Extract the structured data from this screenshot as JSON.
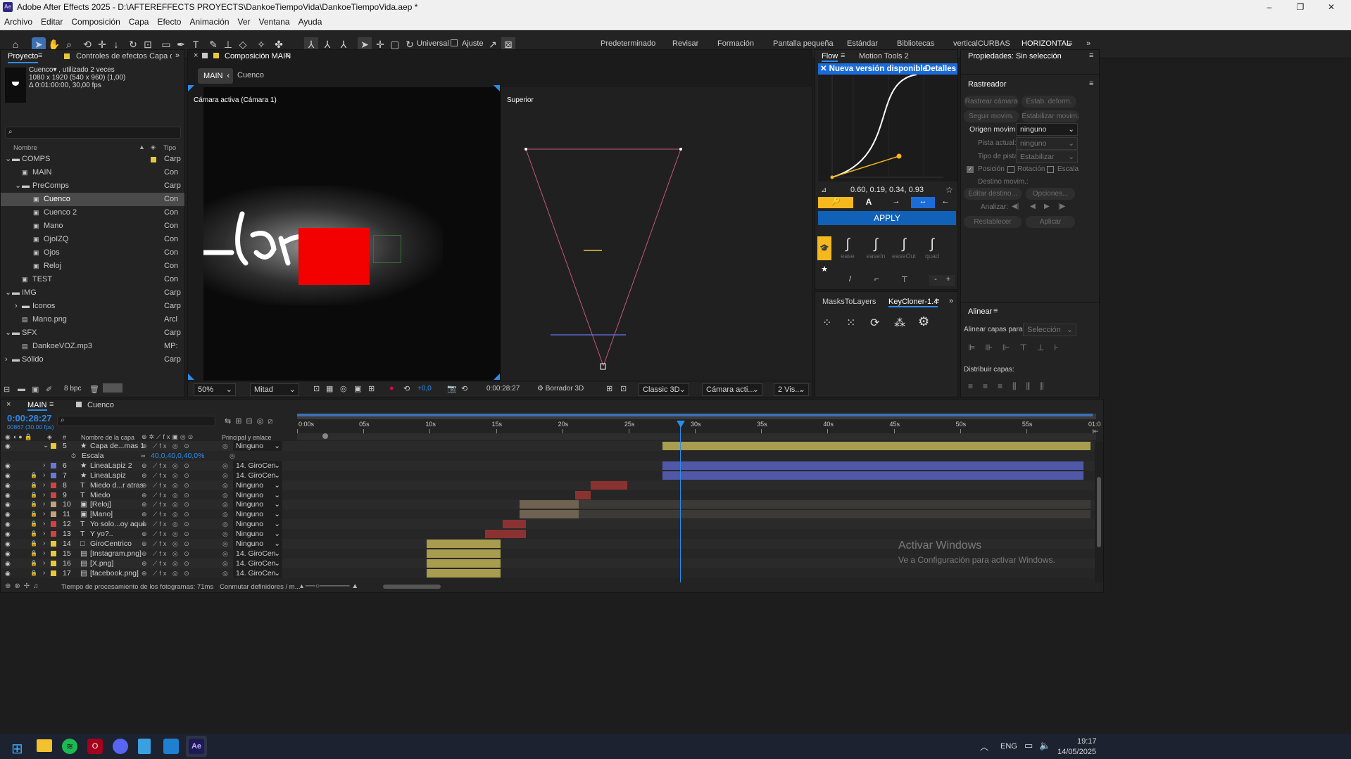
{
  "window": {
    "title": "Adobe After Effects 2025 - D:\\AFTEREFFECTS PROYECTS\\DankoeTiempoVida\\DankoeTiempoVida.aep *",
    "app_icon": "Ae"
  },
  "menu": [
    "Archivo",
    "Editar",
    "Composición",
    "Capa",
    "Efecto",
    "Animación",
    "Ver",
    "Ventana",
    "Ayuda"
  ],
  "toolbar": {
    "universal": "Universal",
    "ajuste": "Ajuste",
    "workspaces": [
      "Predeterminado",
      "Revisar",
      "Formación",
      "Pantalla pequeña",
      "Estándar",
      "Bibliotecas",
      "verticalCURBAS",
      "HORIZONTAL"
    ]
  },
  "project": {
    "tab": "Proyecto",
    "tab2": "Controles de efectos Capa de form",
    "info_name": "Cuenco▾ , utilizado 2 veces",
    "info_dims": "1080 x 1920  (540 x 960) (1,00)",
    "info_dur": "Δ 0:01:00:00, 30,00 fps",
    "col_name": "Nombre",
    "col_type": "Tipo",
    "bpc": "8 bpc",
    "items": [
      {
        "name": "COMPS",
        "type": "Carp"
      },
      {
        "name": "MAIN",
        "type": "Con"
      },
      {
        "name": "PreComps",
        "type": "Carp"
      },
      {
        "name": "Cuenco",
        "type": "Con"
      },
      {
        "name": "Cuenco 2",
        "type": "Con"
      },
      {
        "name": "Mano",
        "type": "Con"
      },
      {
        "name": "OjoIZQ",
        "type": "Con"
      },
      {
        "name": "Ojos",
        "type": "Con"
      },
      {
        "name": "Reloj",
        "type": "Con"
      },
      {
        "name": "TEST",
        "type": "Con"
      },
      {
        "name": "IMG",
        "type": "Carp"
      },
      {
        "name": "Iconos",
        "type": "Carp"
      },
      {
        "name": "Mano.png",
        "type": "Arcl"
      },
      {
        "name": "SFX",
        "type": "Carp"
      },
      {
        "name": "DankoeVOZ.mp3",
        "type": "MP:"
      },
      {
        "name": "Sólido",
        "type": "Carp"
      }
    ]
  },
  "comp": {
    "tab": "Composición MAIN",
    "crumb_main": "MAIN",
    "crumb_sub": "Cuenco",
    "view1": "Cámara activa (Cámara 1)",
    "view2": "Superior",
    "zoom": "50%",
    "res": "Mitad",
    "exposure": "+0,0",
    "time": "0:00:28:27",
    "draft": "Borrador 3D",
    "renderer": "Classic 3D",
    "camera": "Cámara acti...",
    "views": "2 Vis..."
  },
  "flow": {
    "tab1": "Flow",
    "tab2": "Motion Tools 2",
    "banner": "Nueva versión disponible",
    "details": "Detalles",
    "values": "0.60, 0.19, 0.34, 0.93",
    "apply": "APPLY",
    "presets": [
      "ease",
      "easeIn",
      "easeOut",
      "quad"
    ],
    "minus": "-",
    "plus": "+"
  },
  "scripts": {
    "tab1": "MasksToLayers",
    "tab2": "KeyCloner-1.4"
  },
  "props": {
    "title": "Propiedades: Sin selección",
    "tracker": "Rastreador",
    "b1": "Rastrear cámara",
    "b2": "Estab. deform.",
    "b3": "Seguir movim.",
    "b4": "Estabilizar movim.",
    "origin_lbl": "Origen movim.:",
    "origin_val": "ninguno",
    "pista_lbl": "Pista actual:",
    "pista_val": "ninguno",
    "tipo_lbl": "Tipo de pista:",
    "tipo_val": "Estabilizar",
    "pos": "Posición",
    "rot": "Rotación",
    "esc": "Escala",
    "dest": "Destino movim.:",
    "edit": "Editar destino...",
    "opts": "Opciones...",
    "analizar": "Analizar:",
    "reset": "Restablecer",
    "aplicar": "Aplicar",
    "align": "Alinear",
    "align_to": "Alinear capas para:",
    "sel": "Selección",
    "dist": "Distribuir capas:"
  },
  "timeline": {
    "tab1": "MAIN",
    "tab2": "Cuenco",
    "time": "0:00:28:27",
    "frames": "00867 (30.00 fps)",
    "col_name": "Nombre de la capa",
    "col_parent": "Principal y enlace",
    "col_num": "#",
    "ticks": [
      "0:00s",
      "05s",
      "10s",
      "15s",
      "20s",
      "25s",
      "30s",
      "35s",
      "40s",
      "45s",
      "50s",
      "55s",
      "01:0"
    ],
    "footer": "Tiempo de procesamiento de los fotogramas: 71ms",
    "footer2": "Conmutar definidores / m...",
    "layers": [
      {
        "num": "5",
        "name": "Capa de...mas 1",
        "parent": "Ninguno",
        "color": "#e6c83a",
        "icon": "★"
      },
      {
        "num": "",
        "name": "Escala",
        "parent": "",
        "color": "",
        "icon": "",
        "value": "40,0,40,0,40,0%"
      },
      {
        "num": "6",
        "name": "LineaLapiz 2",
        "parent": "14. GiroCen",
        "color": "#6a77d8",
        "icon": "★"
      },
      {
        "num": "7",
        "name": "LineaLapiz",
        "parent": "14. GiroCen",
        "color": "#6a77d8",
        "icon": "★"
      },
      {
        "num": "8",
        "name": "Miedo d...r atras",
        "parent": "Ninguno",
        "color": "#d14343",
        "icon": "T"
      },
      {
        "num": "9",
        "name": "Miedo",
        "parent": "Ninguno",
        "color": "#d14343",
        "icon": "T"
      },
      {
        "num": "10",
        "name": "[Reloj]",
        "parent": "Ninguno",
        "color": "#c2a27a",
        "icon": "▣"
      },
      {
        "num": "11",
        "name": "[Mano]",
        "parent": "Ninguno",
        "color": "#c2a27a",
        "icon": "▣"
      },
      {
        "num": "12",
        "name": "Yo solo...oy aquí.",
        "parent": "Ninguno",
        "color": "#d14343",
        "icon": "T"
      },
      {
        "num": "13",
        "name": "Y yo?..",
        "parent": "Ninguno",
        "color": "#d14343",
        "icon": "T"
      },
      {
        "num": "14",
        "name": "GiroCentrico",
        "parent": "Ninguno",
        "color": "#e6c83a",
        "icon": "□"
      },
      {
        "num": "15",
        "name": "[Instagram.png]",
        "parent": "14. GiroCen",
        "color": "#e6c83a",
        "icon": "▤"
      },
      {
        "num": "16",
        "name": "[X.png]",
        "parent": "14. GiroCen",
        "color": "#e6c83a",
        "icon": "▤"
      },
      {
        "num": "17",
        "name": "[facebook.png]",
        "parent": "14. GiroCen",
        "color": "#e6c83a",
        "icon": "▤"
      }
    ]
  },
  "watermark": {
    "l1": "Activar Windows",
    "l2": "Ve a Configuración para activar Windows."
  },
  "taskbar": {
    "lang": "ENG",
    "time": "19:17",
    "date": "14/05/2025"
  },
  "colors": {
    "accent": "#2d8ceb",
    "yellow": "#e6c83a",
    "blue_bar": "#5058a8",
    "red_bar": "#8a3232",
    "tan_bar": "#6f6250",
    "olive": "#a89c4e"
  }
}
